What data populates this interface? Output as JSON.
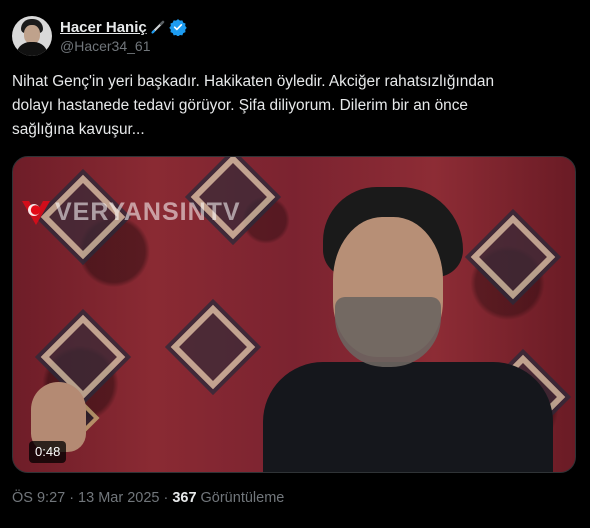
{
  "author": {
    "display_name": "Hacer Haniç",
    "handle": "@Hacer34_61",
    "avatar_icon": "profile-photo",
    "badge_icon": "pen-icon",
    "verified_icon": "verified-badge-icon",
    "verified_color": "#1d9bf0"
  },
  "tweet": {
    "text": "Nihat Genç'in yeri başkadır. Hakikaten öyledir. Akciğer rahatsızlığından\ndolayı hastanede tedavi görüyor. Şifa diliyorum. Dilerim bir an önce\nsağlığına kavuşur..."
  },
  "media": {
    "type": "video",
    "watermark_text": "VERYANSINTV",
    "duration": "0:48"
  },
  "meta": {
    "time": "ÖS 9:27",
    "separator": "·",
    "date": "13 Mar 2025",
    "views_count": "367",
    "views_label": "Görüntüleme"
  },
  "colors": {
    "background": "#000000",
    "text_primary": "#e7e9ea",
    "text_secondary": "#71767b"
  }
}
